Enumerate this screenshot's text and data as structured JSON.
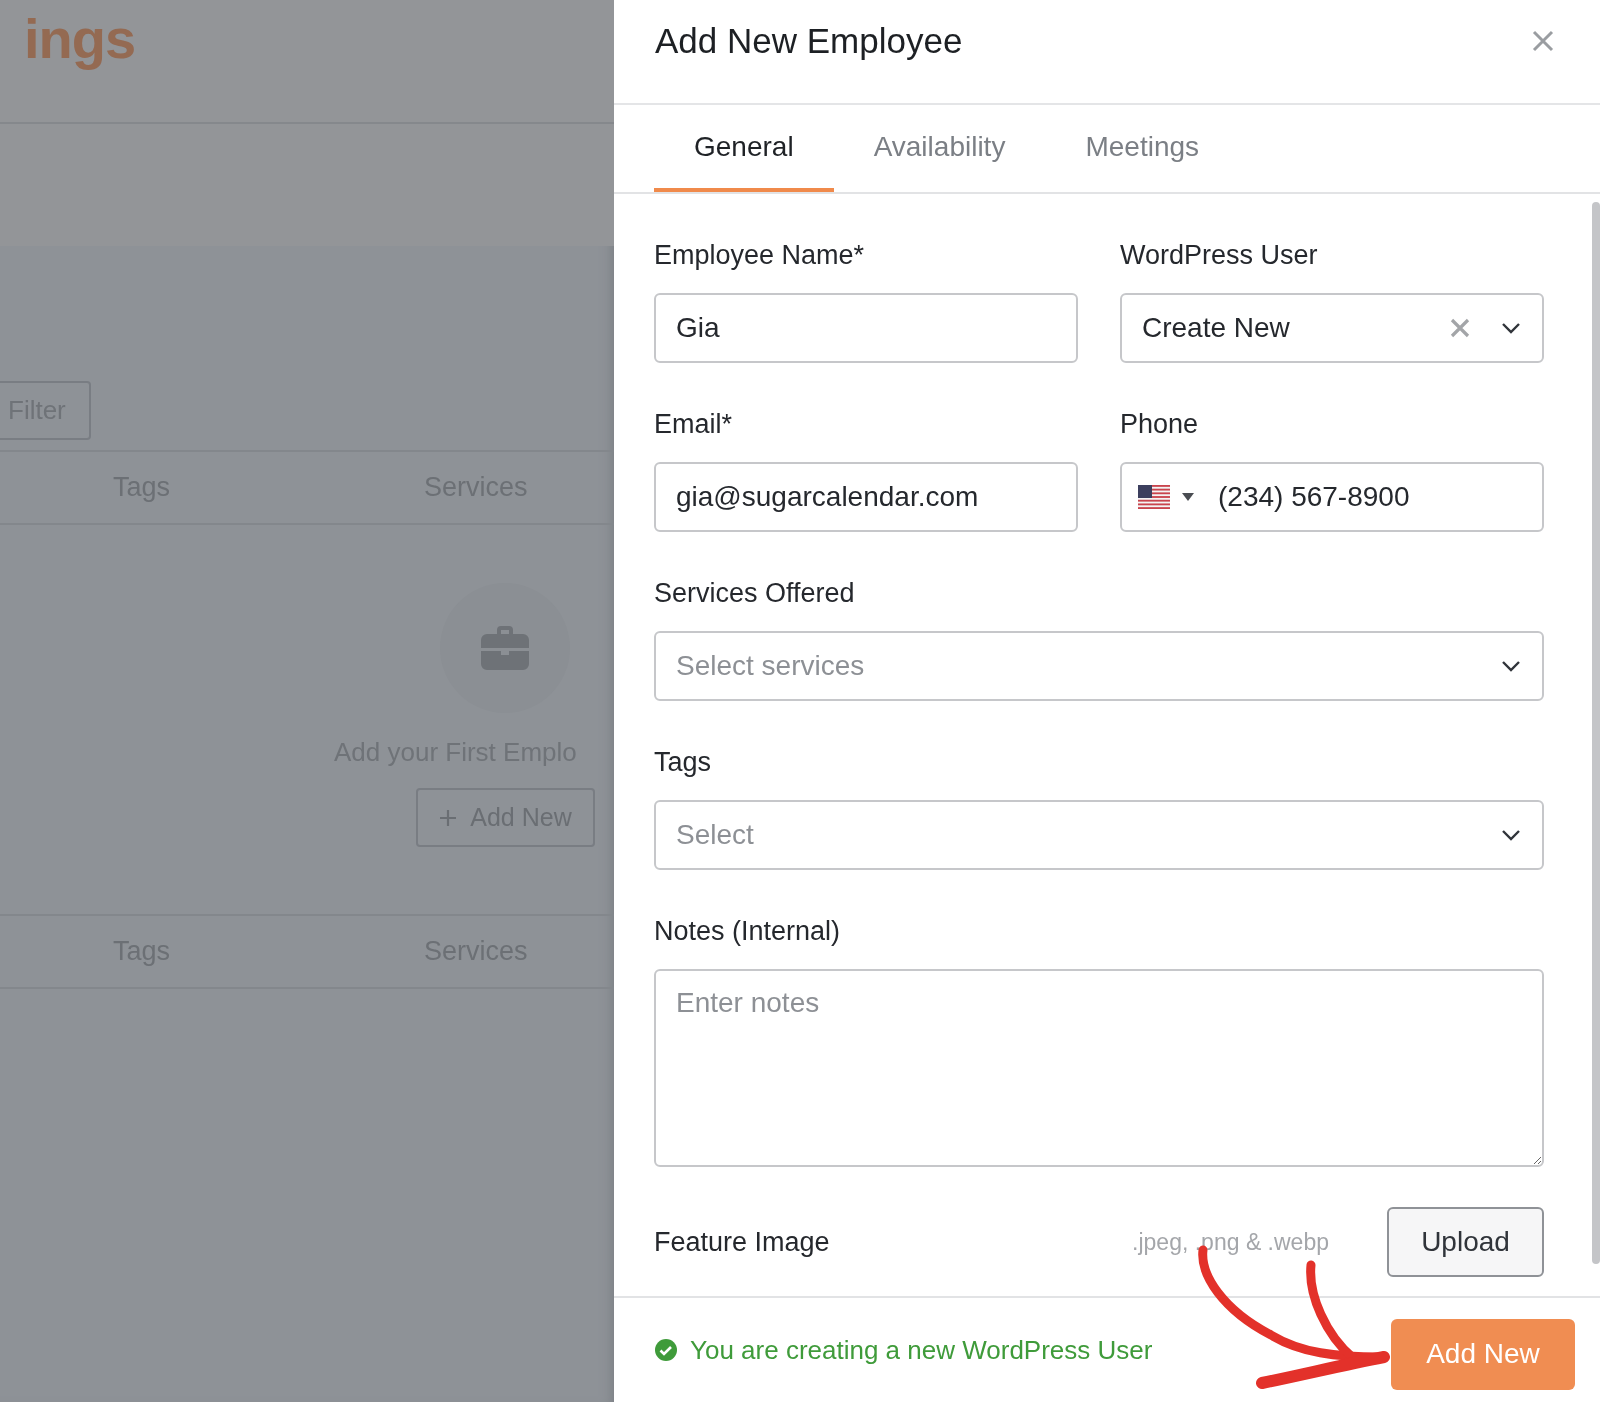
{
  "background_page": {
    "logo": "ings",
    "filter_button": "Filter",
    "table_headers": [
      {
        "columns": [
          "Tags",
          "Services"
        ]
      },
      {
        "columns": [
          "Tags",
          "Services"
        ]
      }
    ],
    "empty_state": {
      "message": "Add your First Emplo",
      "button": "Add New"
    }
  },
  "dialog": {
    "title": "Add New Employee",
    "tabs": [
      {
        "label": "General",
        "selected": true
      },
      {
        "label": "Availability",
        "selected": false
      },
      {
        "label": "Meetings",
        "selected": false
      }
    ],
    "rows": [
      [
        {
          "kind": "text",
          "label": "Employee Name*",
          "value": "Gia"
        },
        {
          "kind": "select",
          "label": "WordPress User",
          "value": "Create New",
          "clearable": true
        }
      ],
      [
        {
          "kind": "text",
          "label": "Email*",
          "value": "gia@sugarcalendar.com"
        },
        {
          "kind": "phone",
          "label": "Phone",
          "value": "(234) 567-8900"
        }
      ],
      [
        {
          "kind": "select",
          "label": "Services Offered",
          "placeholder": "Select services",
          "clearable": false
        }
      ],
      [
        {
          "kind": "select",
          "label": "Tags",
          "placeholder": "Select",
          "clearable": false
        }
      ],
      [
        {
          "kind": "textarea",
          "label": "Notes (Internal)",
          "placeholder": "Enter notes"
        }
      ]
    ],
    "feature_image": {
      "label": "Feature Image",
      "hint": ".jpeg, .png & .webp",
      "button": "Upload"
    },
    "footer": {
      "status": "You are creating a new WordPress User",
      "submit": "Add New"
    }
  }
}
